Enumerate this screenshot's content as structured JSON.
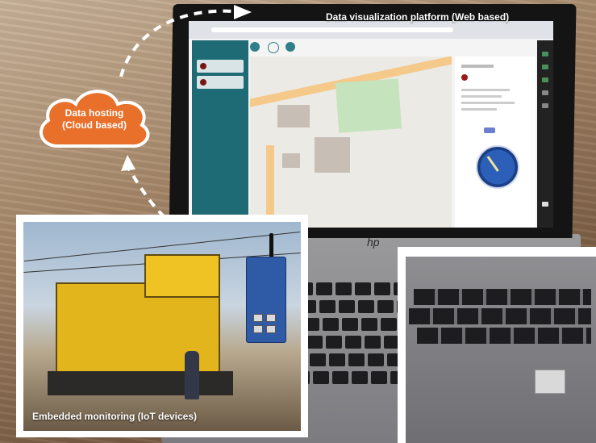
{
  "labels": {
    "platform": "Data visualization platform (Web based)",
    "cloud_line1": "Data hosting",
    "cloud_line2": "(Cloud based)",
    "embedded": "Embedded monitoring (IoT devices)"
  },
  "colors": {
    "cloud": "#e8702a",
    "sidebar": "#1f6b75",
    "train": "#e3b51c",
    "iot_device": "#2f5aa6",
    "arrow": "#ffffff"
  },
  "icons": [
    "dashed-arrow",
    "cloud-icon",
    "antenna-icon",
    "gauge-icon",
    "map-icon"
  ]
}
